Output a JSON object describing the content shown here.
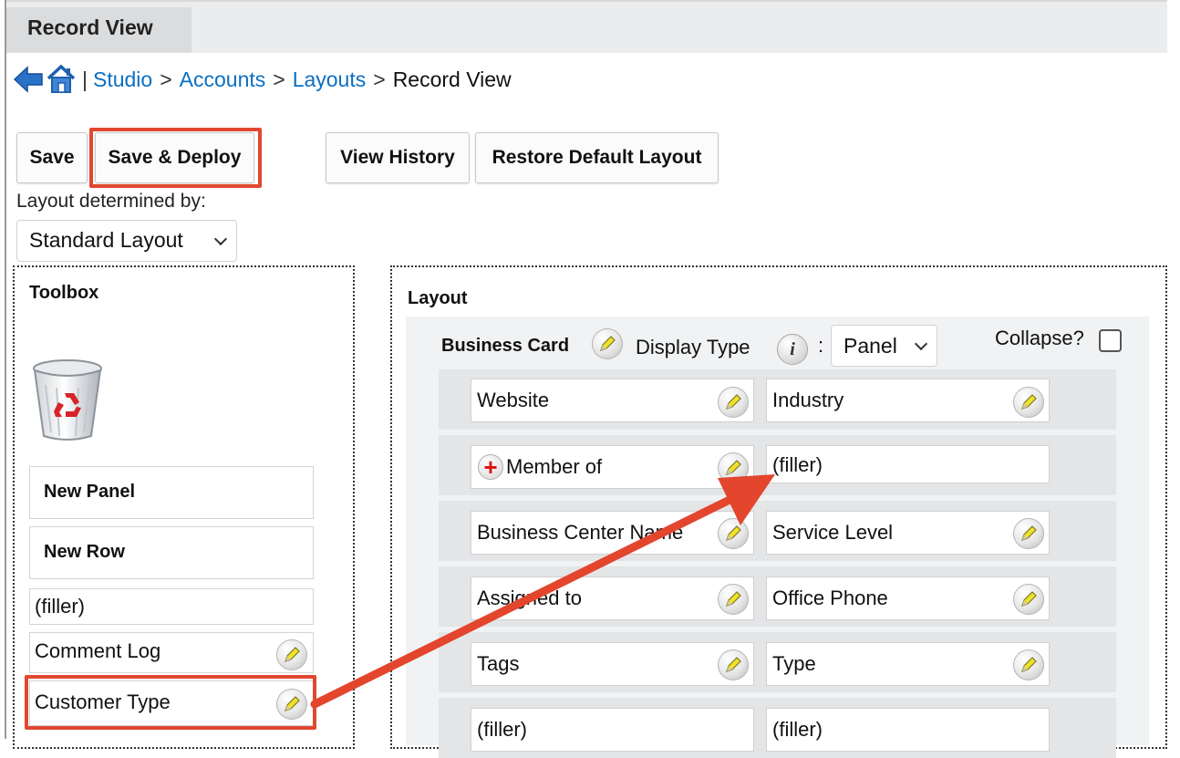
{
  "tab": {
    "label": "Record View"
  },
  "breadcrumb": {
    "separator_pipe": "|",
    "sep": ">",
    "items": [
      "Studio",
      "Accounts",
      "Layouts"
    ],
    "current": "Record View"
  },
  "toolbar": {
    "save": "Save",
    "save_deploy": "Save & Deploy",
    "view_history": "View History",
    "restore_default": "Restore Default Layout"
  },
  "layout_determined": {
    "label": "Layout determined by:",
    "value": "Standard Layout"
  },
  "toolbox": {
    "title": "Toolbox",
    "items": [
      "New Panel",
      "New Row",
      "(filler)",
      "Comment Log",
      "Customer Type"
    ]
  },
  "layout": {
    "title": "Layout",
    "panel_name": "Business Card",
    "display_type_label": "Display Type",
    "display_type_value": "Panel",
    "colon": ":",
    "collapse_label": "Collapse?",
    "rows": [
      [
        "Website",
        "Industry"
      ],
      [
        "Member of",
        "(filler)"
      ],
      [
        "Business Center Name",
        "Service Level"
      ],
      [
        "Assigned to",
        "Office Phone"
      ],
      [
        "Tags",
        "Type"
      ],
      [
        "(filler)",
        "(filler)"
      ]
    ]
  },
  "colors": {
    "link": "#0b6fc2",
    "highlight": "#e0482f",
    "arrow": "#e3452d"
  },
  "icons": [
    "back-arrow-icon",
    "home-icon",
    "trash-icon",
    "pencil-icon",
    "info-icon",
    "plus-icon",
    "chevron-down-icon"
  ]
}
